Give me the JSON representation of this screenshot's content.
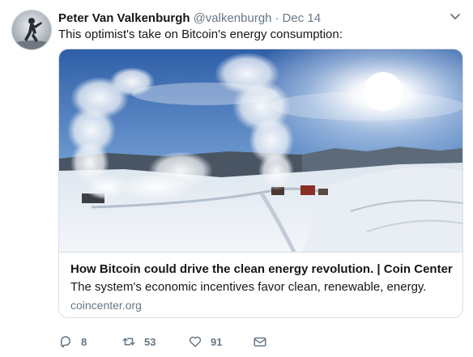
{
  "author": {
    "name": "Peter Van Valkenburgh",
    "handle": "@valkenburgh",
    "separator": "·",
    "date": "Dec 14"
  },
  "tweet": {
    "text": "This optimist's take on Bitcoin's energy consumption:"
  },
  "card": {
    "title": "How Bitcoin could drive the clean energy revolution. | Coin Center",
    "description": "The system's economic incentives favor clean, renewable, energy.",
    "domain": "coincenter.org"
  },
  "actions": {
    "replies": "8",
    "retweets": "53",
    "likes": "91"
  },
  "icons": {
    "reply": "reply-icon",
    "retweet": "retweet-icon",
    "like": "heart-icon",
    "dm": "envelope-icon",
    "menu": "chevron-down-icon"
  },
  "colors": {
    "text": "#14171a",
    "secondary": "#657786",
    "border": "#d8dee3"
  }
}
